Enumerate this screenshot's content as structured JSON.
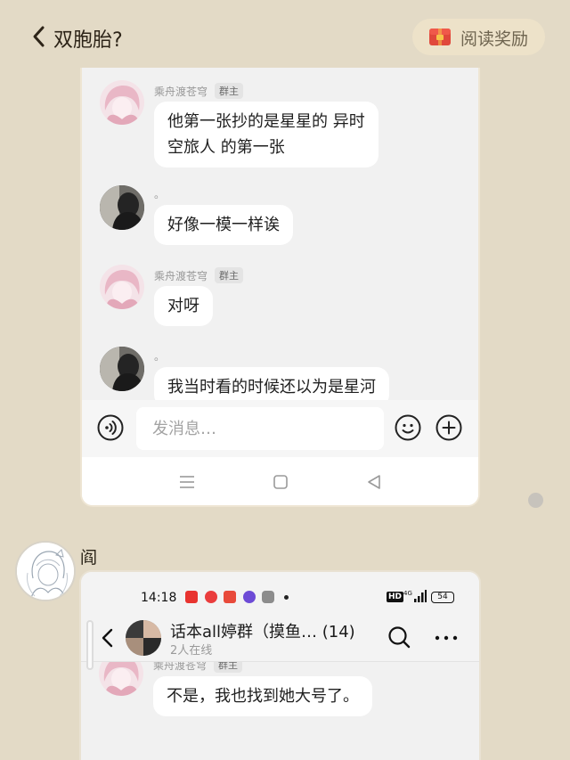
{
  "header": {
    "title": "双胞胎?",
    "reward_label": "阅读奖励"
  },
  "chat1": {
    "messages": [
      {
        "sender": "乘舟渡苍穹",
        "role": "群主",
        "text_lines": [
          "他第一张抄的是星星的 异时",
          "空旅人 的第一张"
        ]
      },
      {
        "sender": "。",
        "role": "",
        "text_lines": [
          "好像一模一样诶"
        ]
      },
      {
        "sender": "乘舟渡苍穹",
        "role": "群主",
        "text_lines": [
          "对呀"
        ]
      },
      {
        "sender": "。",
        "role": "",
        "text_lines": [
          "我当时看的时候还以为是星河"
        ]
      }
    ],
    "input_placeholder": "发消息…"
  },
  "comment": {
    "name": "阎"
  },
  "chat2": {
    "status_time": "14:18",
    "status_battery": "54",
    "status_net": "4G",
    "status_hd": "HD",
    "group_name": "话本all婷群（摸鱼… (14)",
    "online": "2人在线",
    "message_sender": "乘舟渡苍穹",
    "message_role": "群主",
    "message_text": "不是，我也找到她大号了。"
  },
  "colors": {
    "page_bg": "#e3dac6",
    "reward_bg": "#ede2c9",
    "chat_bg": "#f1f1f1",
    "bubble": "#ffffff",
    "gift_red": "#e0483b"
  }
}
